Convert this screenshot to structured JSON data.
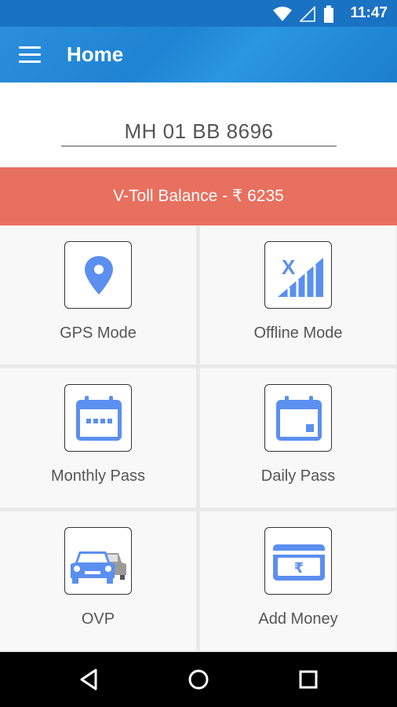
{
  "status_bar": {
    "time": "11:47"
  },
  "app_bar": {
    "title": "Home"
  },
  "vehicle": {
    "plate": "MH 01 BB 8696"
  },
  "balance": {
    "text": "V-Toll Balance - ₹ 6235"
  },
  "tiles": [
    {
      "label": "GPS Mode",
      "icon": "location-pin-icon"
    },
    {
      "label": "Offline Mode",
      "icon": "no-signal-icon"
    },
    {
      "label": "Monthly Pass",
      "icon": "calendar-month-icon"
    },
    {
      "label": "Daily Pass",
      "icon": "calendar-day-icon"
    },
    {
      "label": "OVP",
      "icon": "cars-icon"
    },
    {
      "label": "Add Money",
      "icon": "rupee-card-icon"
    }
  ],
  "colors": {
    "primary": "#1f83d3",
    "balance_bg": "#e8705f",
    "icon_blue": "#5b8ff0"
  }
}
